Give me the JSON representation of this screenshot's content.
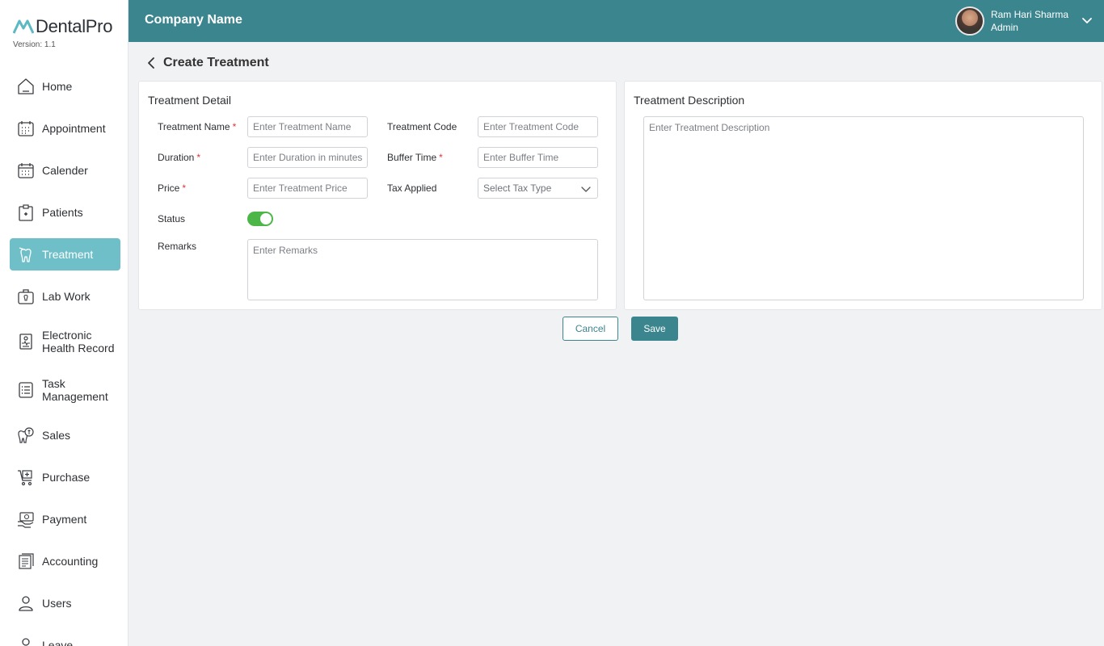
{
  "app": {
    "logo_text": "DentalPro",
    "version": "Version: 1.1"
  },
  "header": {
    "company": "Company Name",
    "user_name": "Ram Hari Sharma",
    "user_role": "Admin"
  },
  "sidebar": {
    "items": [
      {
        "label": "Home",
        "icon": "home-icon"
      },
      {
        "label": "Appointment",
        "icon": "appointment-icon"
      },
      {
        "label": "Calender",
        "icon": "calendar-icon"
      },
      {
        "label": "Patients",
        "icon": "patients-icon"
      },
      {
        "label": "Treatment",
        "icon": "treatment-icon",
        "active": true
      },
      {
        "label": "Lab Work",
        "icon": "lab-work-icon"
      },
      {
        "label": "Electronic Health Record",
        "icon": "health-record-icon"
      },
      {
        "label": "Task Management",
        "icon": "task-icon"
      },
      {
        "label": "Sales",
        "icon": "sales-icon"
      },
      {
        "label": "Purchase",
        "icon": "purchase-icon"
      },
      {
        "label": "Payment",
        "icon": "payment-icon"
      },
      {
        "label": "Accounting",
        "icon": "accounting-icon"
      },
      {
        "label": "Users",
        "icon": "users-icon"
      },
      {
        "label": "Leave",
        "icon": "leave-icon"
      }
    ]
  },
  "page": {
    "title": "Create Treatment"
  },
  "detail": {
    "title": "Treatment Detail",
    "name_label": "Treatment Name",
    "name_placeholder": "Enter Treatment Name",
    "code_label": "Treatment Code",
    "code_placeholder": "Enter Treatment Code",
    "duration_label": "Duration",
    "duration_placeholder": "Enter Duration in minutes",
    "buffer_label": "Buffer Time",
    "buffer_placeholder": "Enter Buffer Time",
    "price_label": "Price",
    "price_placeholder": "Enter Treatment Price",
    "tax_label": "Tax Applied",
    "tax_placeholder": "Select Tax Type",
    "status_label": "Status",
    "status_on": true,
    "remarks_label": "Remarks",
    "remarks_placeholder": "Enter Remarks",
    "required_mark": "*"
  },
  "description": {
    "title": "Treatment Description",
    "placeholder": "Enter Treatment Description"
  },
  "actions": {
    "cancel": "Cancel",
    "save": "Save"
  },
  "colors": {
    "header": "#3b858e",
    "active_nav": "#6ebfc8",
    "toggle_on": "#4cb648",
    "required": "#d9363e"
  }
}
